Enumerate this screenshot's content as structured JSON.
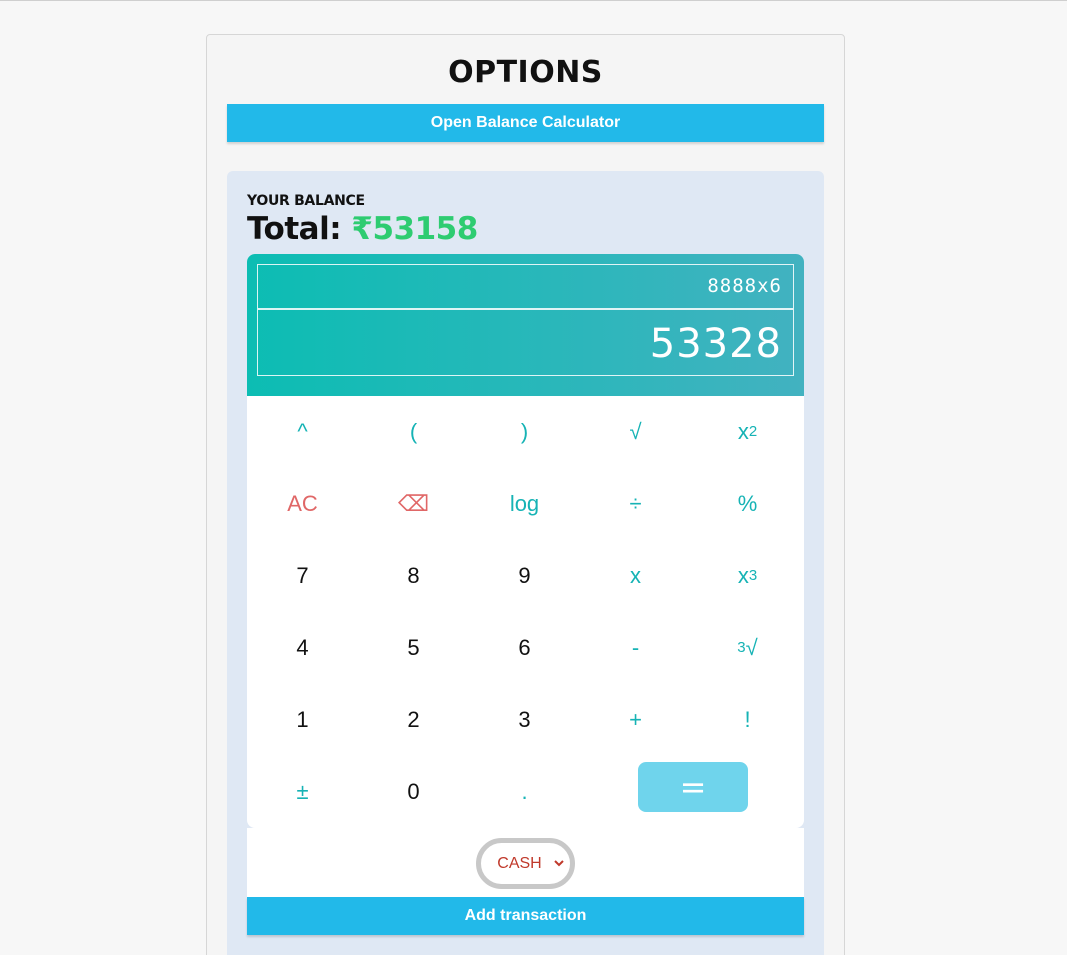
{
  "options": {
    "title": "OPTIONS",
    "open_calculator_label": "Open Balance Calculator"
  },
  "balance": {
    "label": "YOUR BALANCE",
    "total_prefix": "Total:",
    "total_amount": "₹53158"
  },
  "calculator": {
    "expression": "8888x6",
    "result": "53328",
    "keys": {
      "caret": "^",
      "open_paren": "(",
      "close_paren": ")",
      "sqrt": "√",
      "square_base": "x",
      "square_exp": "2",
      "clear": "AC",
      "backspace": "⌫",
      "log": "log",
      "divide": "÷",
      "percent": "%",
      "seven": "7",
      "eight": "8",
      "nine": "9",
      "multiply": "x",
      "cube_base": "x",
      "cube_exp": "3",
      "four": "4",
      "five": "5",
      "six": "6",
      "minus": "-",
      "cbrt_index": "3",
      "cbrt_symbol": "√",
      "one": "1",
      "two": "2",
      "three": "3",
      "plus": "+",
      "factorial": "!",
      "plus_minus": "±",
      "zero": "0",
      "decimal": ".",
      "equals": "="
    }
  },
  "payment": {
    "selected": "CASH"
  },
  "add_transaction_label": "Add transaction",
  "colors": {
    "accent_blue": "#22b9e9",
    "total_green": "#2ecc71",
    "key_teal": "#16b3b5",
    "key_red": "#e06767",
    "equals_bg": "#6fd4ec",
    "select_red": "#c0392b"
  }
}
